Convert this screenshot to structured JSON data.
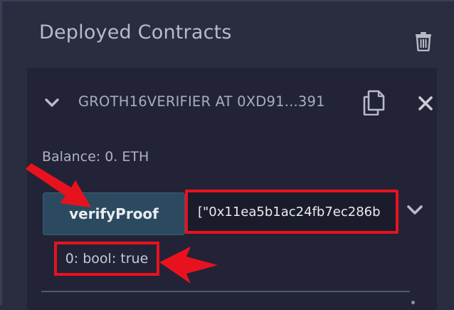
{
  "section": {
    "title": "Deployed Contracts",
    "trash_icon": "trash-icon"
  },
  "contract": {
    "name": "GROTH16VERIFIER AT 0XD91...391",
    "chevron_icon": "chevron-down-icon",
    "copy_icon": "copy-icon",
    "close_icon": "close-icon",
    "balance": "Balance: 0. ETH"
  },
  "function": {
    "button_label": "verifyProof",
    "input_value": "[\"0x11ea5b1ac24fb7ec286b",
    "expand_icon": "chevron-down-icon",
    "result": "0: bool: true"
  },
  "colors": {
    "background": "#2a2c3f",
    "card": "#222336",
    "button": "#2c4a5f",
    "annotation": "#e8121f"
  }
}
